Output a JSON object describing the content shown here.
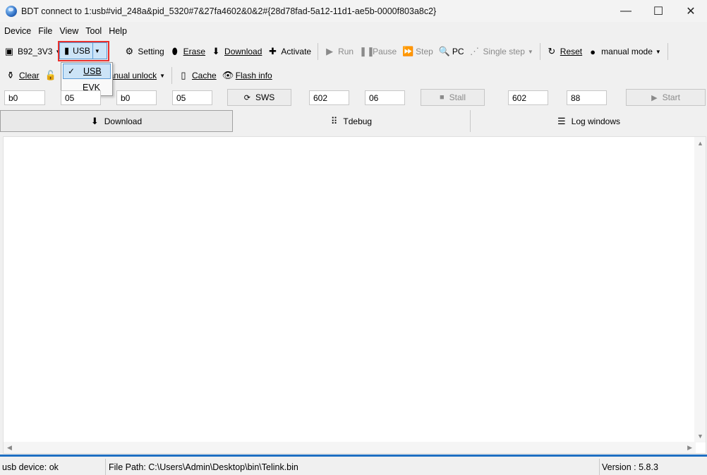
{
  "window": {
    "title": "BDT connect to 1:usb#vid_248a&pid_5320#7&27fa4602&0&2#{28d78fad-5a12-11d1-ae5b-0000f803a8c2}",
    "minimize_glyph": "—",
    "maximize_glyph": "☐",
    "close_glyph": "✕"
  },
  "menu": [
    "Device",
    "File",
    "View",
    "Tool",
    "Help"
  ],
  "toolbar1": {
    "chip_label": "B92_3V3",
    "interface_label": "USB",
    "setting_label": "Setting",
    "erase_label": "Erase",
    "download_label": "Download",
    "activate_label": "Activate",
    "run_label": "Run",
    "pause_label": "Pause",
    "step_label": "Step",
    "pc_label": "PC",
    "single_step_label": "Single step",
    "reset_label": "Reset",
    "mode_label": "manual mode"
  },
  "interface_menu": {
    "items": [
      {
        "label": "USB",
        "checked": true
      },
      {
        "label": "EVK",
        "checked": false
      }
    ]
  },
  "toolbar2": {
    "clear_label": "Clear",
    "unlock_label": "anual unlock",
    "cache_label": "Cache",
    "flash_info_label": "Flash info"
  },
  "fields": {
    "f1": "b0",
    "f2": "05",
    "f3": "b0",
    "f4": "05",
    "sws_label": "SWS",
    "f5": "602",
    "f6": "06",
    "stall_label": "Stall",
    "f7": "602",
    "f8": "88",
    "start_label": "Start"
  },
  "tabs": [
    {
      "label": "Download",
      "active": true
    },
    {
      "label": "Tdebug",
      "active": false
    },
    {
      "label": "Log windows",
      "active": false
    }
  ],
  "status": {
    "device": "usb device: ok",
    "file_path": "File Path:  C:\\Users\\Admin\\Desktop\\bin\\Telink.bin",
    "version": "Version : 5.8.3"
  },
  "colors": {
    "highlight": "#e8312e",
    "accent": "#1f6fc2",
    "selection": "#cce4f7"
  }
}
